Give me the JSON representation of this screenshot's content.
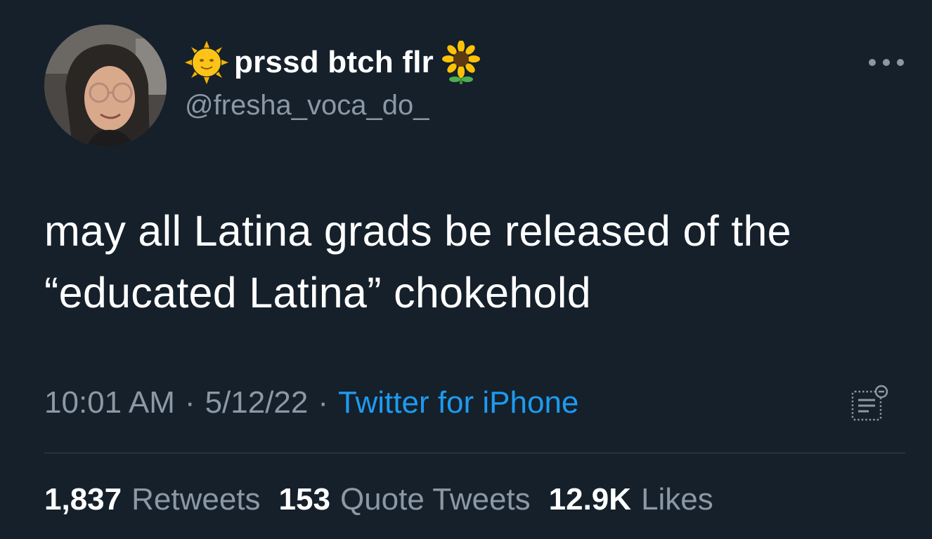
{
  "tweet": {
    "author": {
      "display_name": "prssd btch flr",
      "handle": "@fresha_voca_do_",
      "emoji_before": "sun-with-face-emoji",
      "emoji_after": "sunflower-emoji"
    },
    "text_line1": "may all Latina grads be released of the",
    "text_line2": "“educated Latina” chokehold",
    "time": "10:01 AM",
    "date": "5/12/22",
    "separator": "·",
    "source": "Twitter for iPhone",
    "stats": [
      {
        "count": "1,837",
        "label": "Retweets"
      },
      {
        "count": "153",
        "label": "Quote Tweets"
      },
      {
        "count": "12.9K",
        "label": "Likes"
      }
    ]
  },
  "icons": {
    "more": "more-horizontal-icon",
    "analytics": "tweet-analytics-icon"
  },
  "colors": {
    "background": "#15202b",
    "text_primary": "#ffffff",
    "text_secondary": "#8b98a5",
    "link": "#1d9bf0",
    "divider": "#38444d"
  }
}
